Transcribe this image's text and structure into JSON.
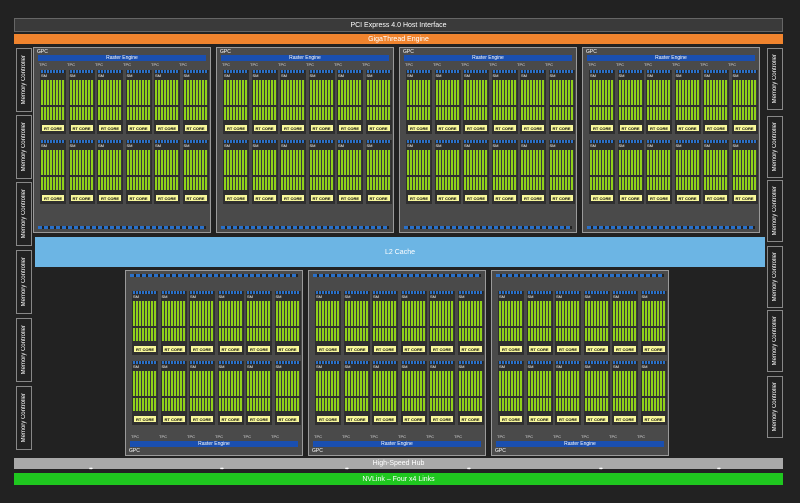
{
  "bars": {
    "pcie": "PCI Express 4.0 Host Interface",
    "gigathread": "GigaThread Engine",
    "l2": "L2 Cache",
    "hub": "High-Speed Hub",
    "nvlink": "NVLink – Four x4 Links"
  },
  "memory_controller_label": "Memory Controller",
  "gpc": {
    "label": "GPC",
    "raster": "Raster Engine",
    "tpc": "TPC",
    "polymorph": "PolyMorph Engine",
    "sm": "SM",
    "rt": "RT CORE"
  },
  "colors": {
    "background": "#222222",
    "gigathread": "#f0842e",
    "l2": "#6cb5e4",
    "nvlink": "#1fc71f",
    "hub": "#a9a9a9",
    "raster": "#1a4fb0",
    "cuda": "#8fd11a",
    "rt_core": "#f7f79a"
  }
}
